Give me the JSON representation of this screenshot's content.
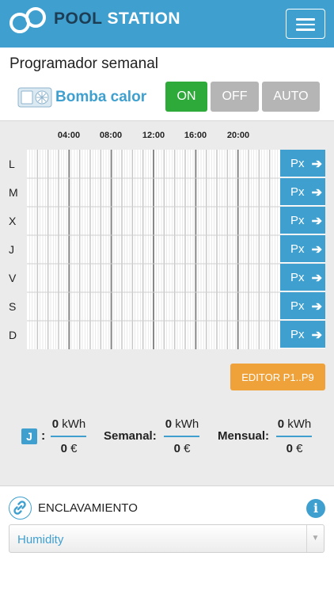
{
  "header": {
    "brand_part1": "POOL",
    "brand_part2": "STATION",
    "logo_icon": "pool-station-logo-icon",
    "menu_icon": "hamburger-icon"
  },
  "page": {
    "title": "Programador semanal"
  },
  "device": {
    "icon": "heat-pump-icon",
    "label": "Bomba calor",
    "modes": [
      {
        "label": "ON",
        "active": true,
        "color": "#2eaa3a"
      },
      {
        "label": "OFF",
        "active": false,
        "color": "#b5b5b5"
      },
      {
        "label": "AUTO",
        "active": false,
        "color": "#b5b5b5"
      }
    ]
  },
  "schedule": {
    "hours": [
      "04:00",
      "08:00",
      "12:00",
      "16:00",
      "20:00"
    ],
    "days": [
      {
        "label": "L",
        "program": "Px"
      },
      {
        "label": "M",
        "program": "Px"
      },
      {
        "label": "X",
        "program": "Px"
      },
      {
        "label": "J",
        "program": "Px"
      },
      {
        "label": "V",
        "program": "Px"
      },
      {
        "label": "S",
        "program": "Px"
      },
      {
        "label": "D",
        "program": "Px"
      }
    ],
    "slot_count": 96,
    "editor_button": "EDITOR P1..P9"
  },
  "stats": {
    "today_badge": "J",
    "today_sep": ":",
    "today_kwh": "0",
    "today_eur": "0",
    "weekly_label": "Semanal:",
    "weekly_kwh": "0",
    "weekly_eur": "0",
    "monthly_label": "Mensual:",
    "monthly_kwh": "0",
    "monthly_eur": "0",
    "kwh_unit": "kWh",
    "eur_unit": "€"
  },
  "interlock": {
    "icon": "link-icon",
    "label": "ENCLAVAMIENTO",
    "info_icon": "info-icon",
    "select_value": "Humidity"
  },
  "colors": {
    "accent": "#3fa0cf",
    "on": "#2eaa3a",
    "inactive": "#b5b5b5",
    "editor": "#f0a23a"
  }
}
